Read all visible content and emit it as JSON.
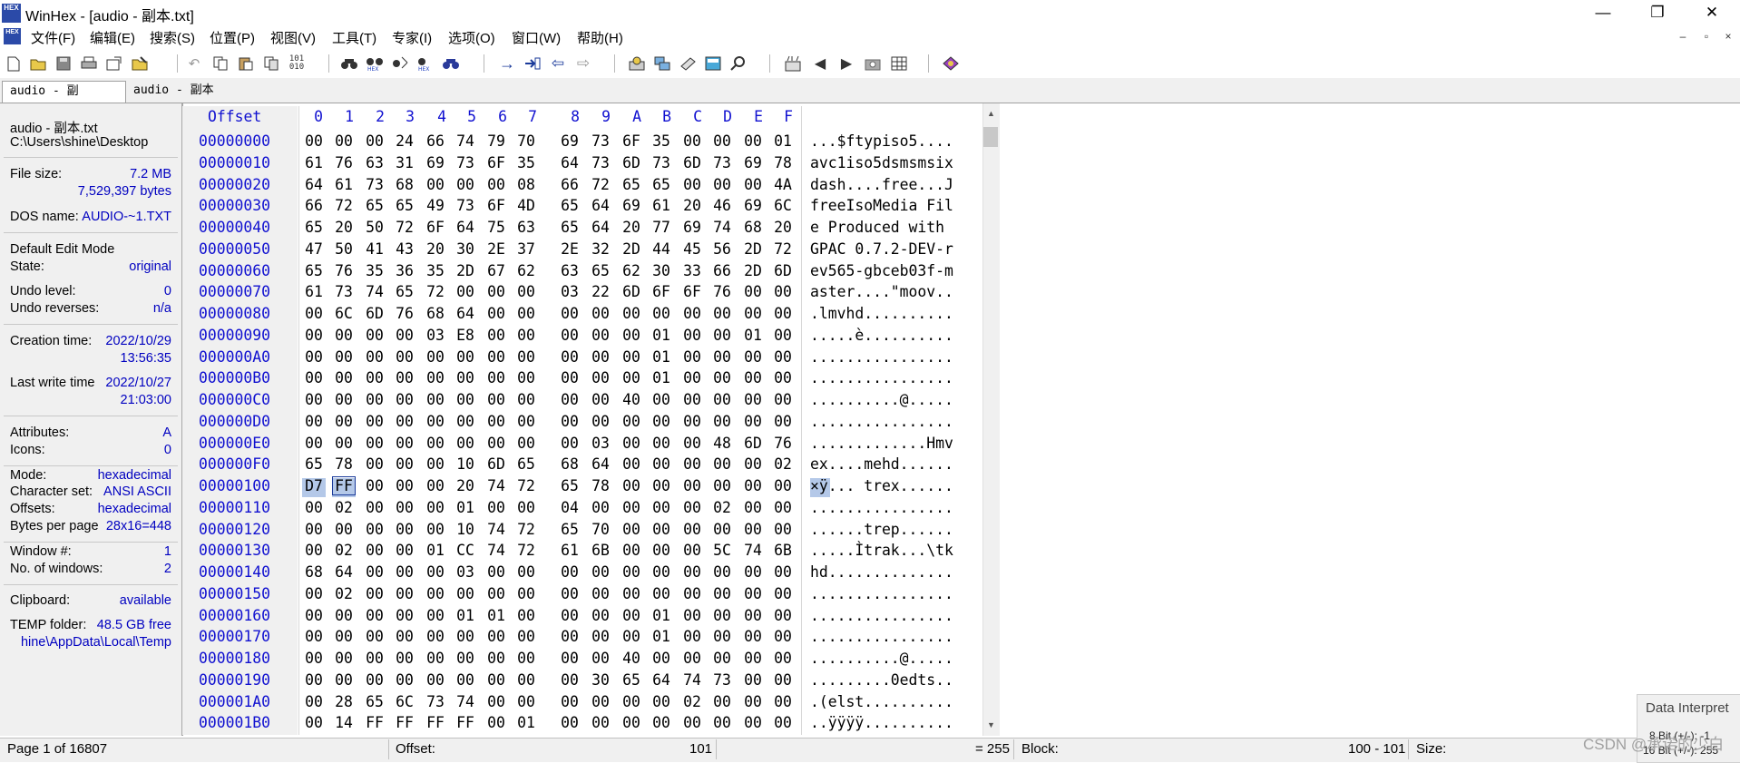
{
  "window": {
    "title": "WinHex - [audio - 副本.txt]",
    "logo_text": "HEX",
    "minimize": "—",
    "restore": "❐",
    "close": "✕"
  },
  "menu": {
    "items": [
      "文件(F)",
      "编辑(E)",
      "搜索(S)",
      "位置(P)",
      "视图(V)",
      "工具(T)",
      "专家(I)",
      "选项(O)",
      "窗口(W)",
      "帮助(H)"
    ],
    "mdi_min": "–",
    "mdi_restore": "▫",
    "mdi_close": "×"
  },
  "toolbar": {
    "icons": [
      "new-file-icon",
      "open-folder-icon",
      "save-icon",
      "print-icon",
      "properties-icon",
      "open-edit-icon",
      "undo-icon",
      "copy-icon",
      "paste-icon",
      "paste-special-icon",
      "binary-convert-icon",
      "find-text-icon",
      "find-hex-icon",
      "replace-text-icon",
      "replace-hex-icon",
      "find-again-icon",
      "goto-offset-icon",
      "goto-cluster-icon",
      "back-arrow-icon",
      "forward-arrow-icon",
      "open-disk-icon",
      "clone-disk-icon",
      "ram-editor-icon",
      "calculator-icon",
      "zoom-icon",
      "analyze-icon",
      "prev-icon",
      "next-icon",
      "camera-icon",
      "grid-icon",
      "case-data-icon"
    ],
    "glyphs": {
      "undo-icon": "↶",
      "back-arrow-icon": "⇦",
      "forward-arrow-icon": "⇨",
      "goto-offset-icon": "→",
      "prev-icon": "◀",
      "next-icon": "▶",
      "zoom-icon": "⌕",
      "find-text-icon": "🔍"
    }
  },
  "tabs": [
    {
      "label": "audio - 副本.txt",
      "active": true
    },
    {
      "label": "audio - 副本ansi.txt",
      "active": false
    }
  ],
  "info": {
    "filename": "audio - 副本.txt",
    "path": "C:\\Users\\shine\\Desktop",
    "file_size_label": "File size:",
    "file_size_mb": "7.2 MB",
    "file_size_bytes": "7,529,397 bytes",
    "dos_name_label": "DOS name:",
    "dos_name": "AUDIO-~1.TXT",
    "edit_mode": "Default Edit Mode",
    "state_label": "State:",
    "state": "original",
    "undo_level_label": "Undo level:",
    "undo_level": "0",
    "undo_reverses_label": "Undo reverses:",
    "undo_reverses": "n/a",
    "creation_label": "Creation time:",
    "creation_date": "2022/10/29",
    "creation_time": "13:56:35",
    "lastwrite_label": "Last write time",
    "lastwrite_date": "2022/10/27",
    "lastwrite_time": "21:03:00",
    "attributes_label": "Attributes:",
    "attributes": "A",
    "icons_label": "Icons:",
    "icons": "0",
    "mode_label": "Mode:",
    "mode": "hexadecimal",
    "charset_label": "Character set:",
    "charset": "ANSI ASCII",
    "offsets_label": "Offsets:",
    "offsets": "hexadecimal",
    "bpp_label": "Bytes per page",
    "bpp": "28x16=448",
    "window_label": "Window #:",
    "window": "1",
    "nwindows_label": "No. of windows:",
    "nwindows": "2",
    "clipboard_label": "Clipboard:",
    "clipboard": "available",
    "temp_label": "TEMP folder:",
    "temp_free": "48.5 GB free",
    "temp_path": "hine\\AppData\\Local\\Temp"
  },
  "hex": {
    "offset_header": "Offset",
    "columns": [
      "0",
      "1",
      "2",
      "3",
      "4",
      "5",
      "6",
      "7",
      "8",
      "9",
      "A",
      "B",
      "C",
      "D",
      "E",
      "F"
    ],
    "rows": [
      {
        "offset": "00000000",
        "bytes": "00 00 00 24 66 74 79 70 69 73 6F 35 00 00 00 01",
        "ascii": "...$ftypiso5...."
      },
      {
        "offset": "00000010",
        "bytes": "61 76 63 31 69 73 6F 35 64 73 6D 73 6D 73 69 78",
        "ascii": "avc1iso5dsmsmsix"
      },
      {
        "offset": "00000020",
        "bytes": "64 61 73 68 00 00 00 08 66 72 65 65 00 00 00 4A",
        "ascii": "dash....free...J"
      },
      {
        "offset": "00000030",
        "bytes": "66 72 65 65 49 73 6F 4D 65 64 69 61 20 46 69 6C",
        "ascii": "freeIsoMedia Fil"
      },
      {
        "offset": "00000040",
        "bytes": "65 20 50 72 6F 64 75 63 65 64 20 77 69 74 68 20",
        "ascii": "e Produced with "
      },
      {
        "offset": "00000050",
        "bytes": "47 50 41 43 20 30 2E 37 2E 32 2D 44 45 56 2D 72",
        "ascii": "GPAC 0.7.2-DEV-r"
      },
      {
        "offset": "00000060",
        "bytes": "65 76 35 36 35 2D 67 62 63 65 62 30 33 66 2D 6D",
        "ascii": "ev565-gbceb03f-m"
      },
      {
        "offset": "00000070",
        "bytes": "61 73 74 65 72 00 00 00 03 22 6D 6F 6F 76 00 00",
        "ascii": "aster....\"moov.."
      },
      {
        "offset": "00000080",
        "bytes": "00 6C 6D 76 68 64 00 00 00 00 00 00 00 00 00 00",
        "ascii": ".lmvhd.........."
      },
      {
        "offset": "00000090",
        "bytes": "00 00 00 00 03 E8 00 00 00 00 00 01 00 00 01 00",
        "ascii": ".....è.........."
      },
      {
        "offset": "000000A0",
        "bytes": "00 00 00 00 00 00 00 00 00 00 00 01 00 00 00 00",
        "ascii": "................"
      },
      {
        "offset": "000000B0",
        "bytes": "00 00 00 00 00 00 00 00 00 00 00 01 00 00 00 00",
        "ascii": "................"
      },
      {
        "offset": "000000C0",
        "bytes": "00 00 00 00 00 00 00 00 00 00 40 00 00 00 00 00",
        "ascii": "..........@....."
      },
      {
        "offset": "000000D0",
        "bytes": "00 00 00 00 00 00 00 00 00 00 00 00 00 00 00 00",
        "ascii": "................"
      },
      {
        "offset": "000000E0",
        "bytes": "00 00 00 00 00 00 00 00 00 03 00 00 00 48 6D 76",
        "ascii": ".............Hmv"
      },
      {
        "offset": "000000F0",
        "bytes": "65 78 00 00 00 10 6D 65 68 64 00 00 00 00 00 02",
        "ascii": "ex....mehd......"
      },
      {
        "offset": "00000100",
        "bytes": "D7 FF 00 00 00 20 74 72 65 78 00 00 00 00 00 00",
        "ascii": "×ÿ... trex......"
      },
      {
        "offset": "00000110",
        "bytes": "00 02 00 00 00 01 00 00 04 00 00 00 00 02 00 00",
        "ascii": "................"
      },
      {
        "offset": "00000120",
        "bytes": "00 00 00 00 00 10 74 72 65 70 00 00 00 00 00 00",
        "ascii": "......trep......"
      },
      {
        "offset": "00000130",
        "bytes": "00 02 00 00 01 CC 74 72 61 6B 00 00 00 5C 74 6B",
        "ascii": ".....Ìtrak...\\tk"
      },
      {
        "offset": "00000140",
        "bytes": "68 64 00 00 00 03 00 00 00 00 00 00 00 00 00 00",
        "ascii": "hd.............."
      },
      {
        "offset": "00000150",
        "bytes": "00 02 00 00 00 00 00 00 00 00 00 00 00 00 00 00",
        "ascii": "................"
      },
      {
        "offset": "00000160",
        "bytes": "00 00 00 00 00 01 01 00 00 00 00 01 00 00 00 00",
        "ascii": "................"
      },
      {
        "offset": "00000170",
        "bytes": "00 00 00 00 00 00 00 00 00 00 00 01 00 00 00 00",
        "ascii": "................"
      },
      {
        "offset": "00000180",
        "bytes": "00 00 00 00 00 00 00 00 00 00 40 00 00 00 00 00",
        "ascii": "..........@....."
      },
      {
        "offset": "00000190",
        "bytes": "00 00 00 00 00 00 00 00 00 30 65 64 74 73 00 00",
        "ascii": ".........0edts.."
      },
      {
        "offset": "000001A0",
        "bytes": "00 28 65 6C 73 74 00 00 00 00 00 00 02 00 00 00",
        "ascii": ".(elst.........."
      },
      {
        "offset": "000001B0",
        "bytes": "00 14 FF FF FF FF 00 01 00 00 00 00 00 00 00 00",
        "ascii": "..ÿÿÿÿ.........."
      }
    ],
    "selection": {
      "row": 16,
      "hex_cols": [
        0,
        1
      ],
      "cursor_col": 1
    }
  },
  "status": {
    "page": "Page 1 of 16807",
    "offset_label": "Offset:",
    "offset_value": "101",
    "eq_value": "= 255",
    "block_label": "Block:",
    "block_value": "100 - 101",
    "size_label": "Size:"
  },
  "interpreter": {
    "title": "Data Interpret",
    "line1": "8 Bit (+/-): -1",
    "line2": "16 Bit (+/-): 255"
  },
  "watermark": "CSDN @承诺的少白"
}
